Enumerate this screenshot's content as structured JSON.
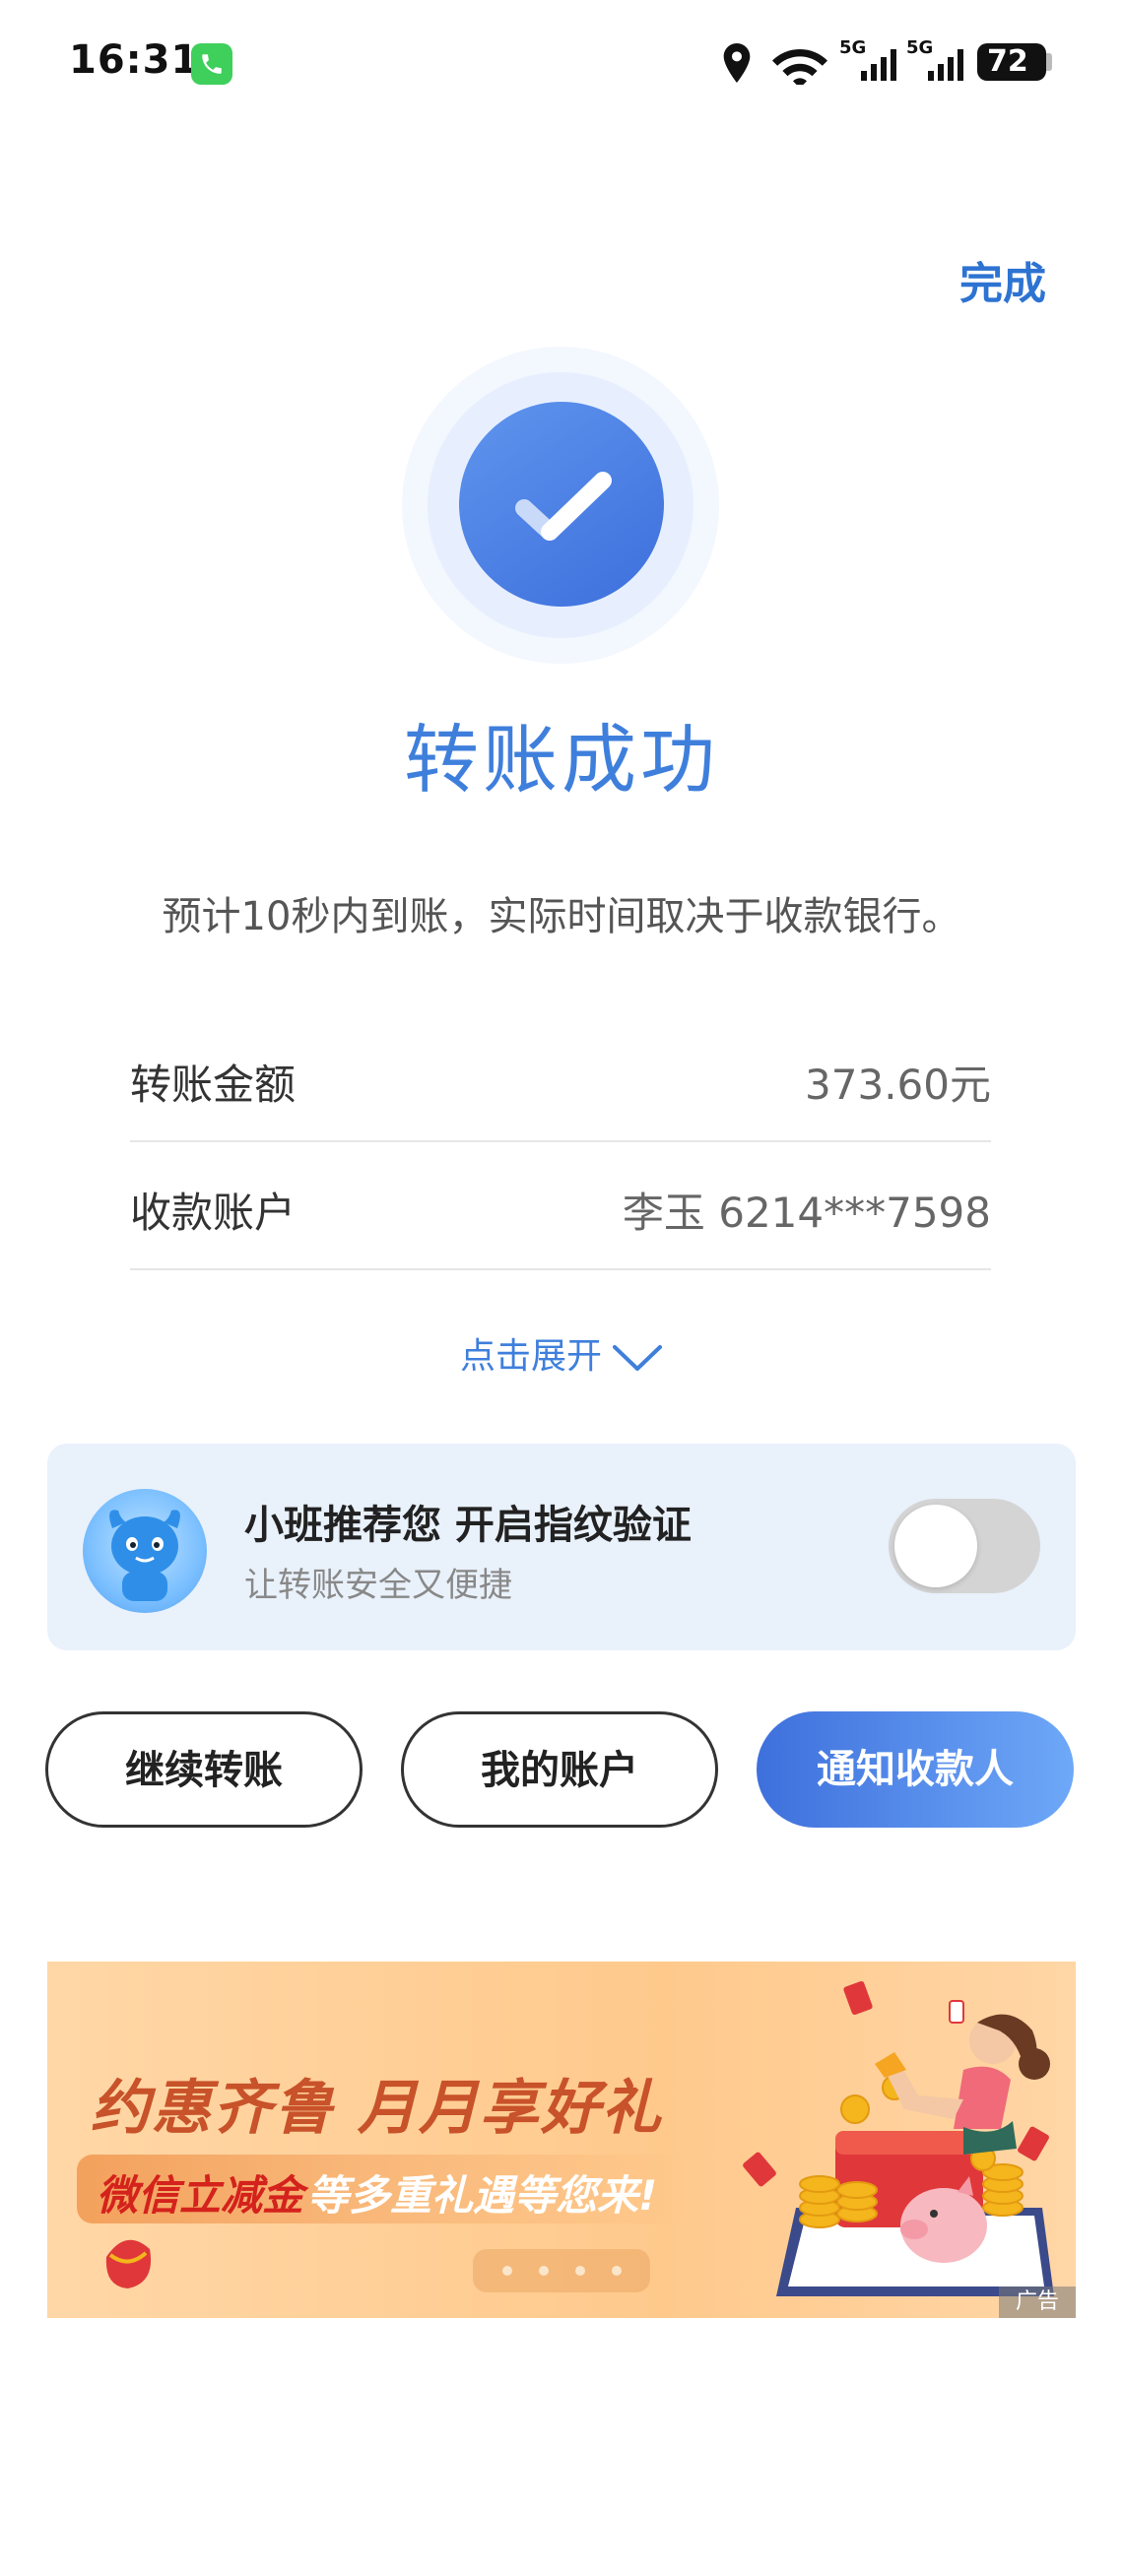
{
  "status_bar": {
    "time": "16:31",
    "battery": "72",
    "network_label": "5G",
    "icons": [
      "phone-call-icon",
      "location-icon",
      "wifi-icon",
      "signal-5g-icon",
      "signal-5g-icon",
      "battery-icon"
    ]
  },
  "header": {
    "done_label": "完成"
  },
  "result": {
    "title": "转账成功",
    "subtitle": "预计10秒内到账，实际时间取决于收款银行。",
    "icon": "check-circle-icon",
    "accent_color": "#3f7fdc"
  },
  "details": {
    "rows": [
      {
        "label": "转账金额",
        "value": "373.60元"
      },
      {
        "label": "收款账户",
        "value": "李玉 6214***7598"
      }
    ],
    "expand_label": "点击展开"
  },
  "fingerprint_card": {
    "title": "小班推荐您 开启指纹验证",
    "subtitle": "让转账安全又便捷",
    "toggle_on": false
  },
  "actions": {
    "continue_label": "继续转账",
    "account_label": "我的账户",
    "notify_label": "通知收款人"
  },
  "banner": {
    "title": "约惠齐鲁 月月享好礼",
    "subtitle_red": "微信立减金",
    "subtitle_white": "等多重礼遇等您来!",
    "ad_label": "广告",
    "page_count": 4
  }
}
